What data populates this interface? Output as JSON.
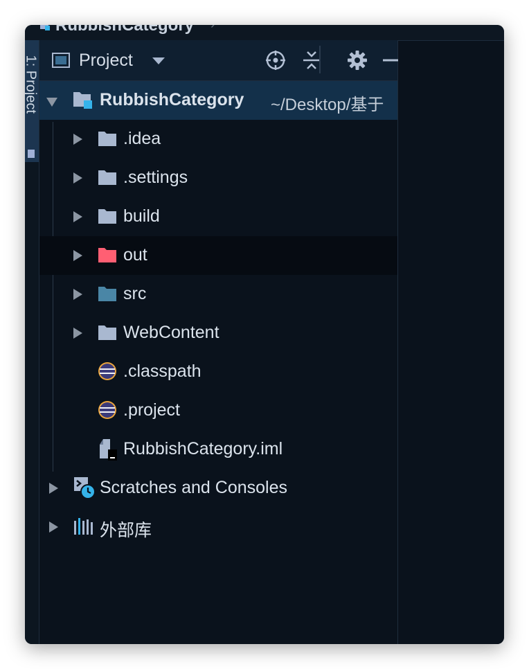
{
  "breadcrumb": {
    "text": "RubbishCategory",
    "separator": "›"
  },
  "stripe": {
    "tab_label": "1: Project"
  },
  "header": {
    "title": "Project",
    "actions": [
      "locate-icon",
      "collapse-all-icon",
      "gear-icon",
      "minimize-icon"
    ]
  },
  "tree": {
    "root": {
      "name": "RubbishCategory",
      "path": "~/Desktop/基于"
    },
    "items": [
      {
        "name": ".idea",
        "icon": "folder-icon"
      },
      {
        "name": ".settings",
        "icon": "folder-icon"
      },
      {
        "name": "build",
        "icon": "folder-icon"
      },
      {
        "name": "out",
        "icon": "excluded-folder-icon"
      },
      {
        "name": "src",
        "icon": "source-folder-icon"
      },
      {
        "name": "WebContent",
        "icon": "folder-icon"
      },
      {
        "name": ".classpath",
        "icon": "eclipse-file-icon"
      },
      {
        "name": ".project",
        "icon": "eclipse-file-icon"
      },
      {
        "name": "RubbishCategory.iml",
        "icon": "module-file-icon"
      }
    ],
    "scratches": "Scratches and Consoles",
    "external_libs": "外部库"
  },
  "colors": {
    "background": "#0a121c",
    "selection": "#13304a",
    "folder": "#a9b8d0",
    "excluded_folder": "#ff5f73",
    "source_folder": "#4a86a6"
  }
}
